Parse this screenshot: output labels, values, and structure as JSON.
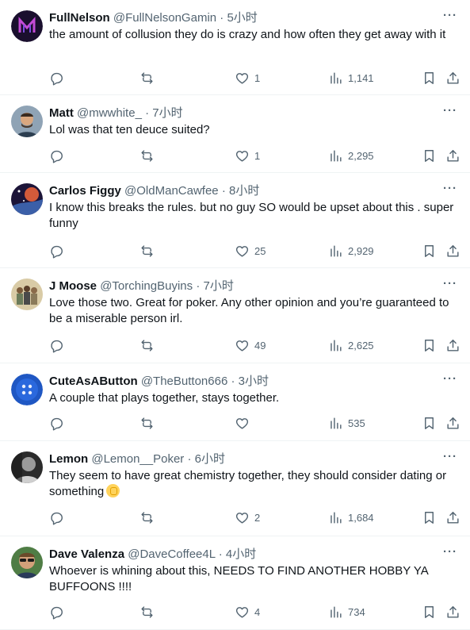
{
  "tweets": [
    {
      "name": "FullNelson",
      "handle": "@FullNelsonGamin",
      "dot": "·",
      "time": "5小时",
      "text": "the amount of collusion they do is crazy and how often they get away with it",
      "likes": "1",
      "views": "1,141",
      "avatar_icon": "fullnelson-logo-icon",
      "avatar_color": "#1a0f2e"
    },
    {
      "name": "Matt",
      "handle": "@mwwhite_",
      "dot": "·",
      "time": "7小时",
      "text": "Lol was that ten deuce suited?",
      "likes": "1",
      "views": "2,295",
      "avatar_icon": "person-photo-icon",
      "avatar_color": "#6a7b8c"
    },
    {
      "name": "Carlos Figgy",
      "handle": "@OldManCawfee",
      "dot": "·",
      "time": "8小时",
      "text": "I know this breaks the rules. but no guy SO would be upset about this . super funny",
      "likes": "25",
      "views": "2,929",
      "avatar_icon": "space-art-icon",
      "avatar_color": "#2a1f4a"
    },
    {
      "name": "J Moose",
      "handle": "@TorchingBuyins",
      "dot": "·",
      "time": "7小时",
      "text": "Love those two. Great for poker. Any other opinion and you’re  guaranteed to be a miserable person irl.",
      "likes": "49",
      "views": "2,625",
      "avatar_icon": "group-photo-icon",
      "avatar_color": "#c9b894"
    },
    {
      "name": "CuteAsAButton",
      "handle": "@TheButton666",
      "dot": "·",
      "time": "3小时",
      "text": "A couple that plays together, stays together.",
      "likes": "",
      "views": "535",
      "avatar_icon": "blue-button-icon",
      "avatar_color": "#1f57c3"
    },
    {
      "name": "Lemon",
      "handle": "@Lemon__Poker",
      "dot": "·",
      "time": "6小时",
      "text": "They seem to have great chemistry together, they should consider dating or something",
      "likes": "2",
      "views": "1,684",
      "avatar_icon": "bw-photo-icon",
      "avatar_color": "#4a4a4a",
      "emoji": "fist-emoji-icon"
    },
    {
      "name": "Dave Valenza",
      "handle": "@DaveCoffee4L",
      "dot": "·",
      "time": "4小时",
      "text": "Whoever is whining about this, NEEDS TO FIND ANOTHER HOBBY YA BUFFOONS !!!!",
      "likes": "4",
      "views": "734",
      "avatar_icon": "sunglasses-person-icon",
      "avatar_color": "#3b6a3a"
    }
  ],
  "more_label": "···",
  "colors": {
    "secondary": "#536471",
    "divider": "#eff3f4",
    "text": "#0f1419"
  }
}
